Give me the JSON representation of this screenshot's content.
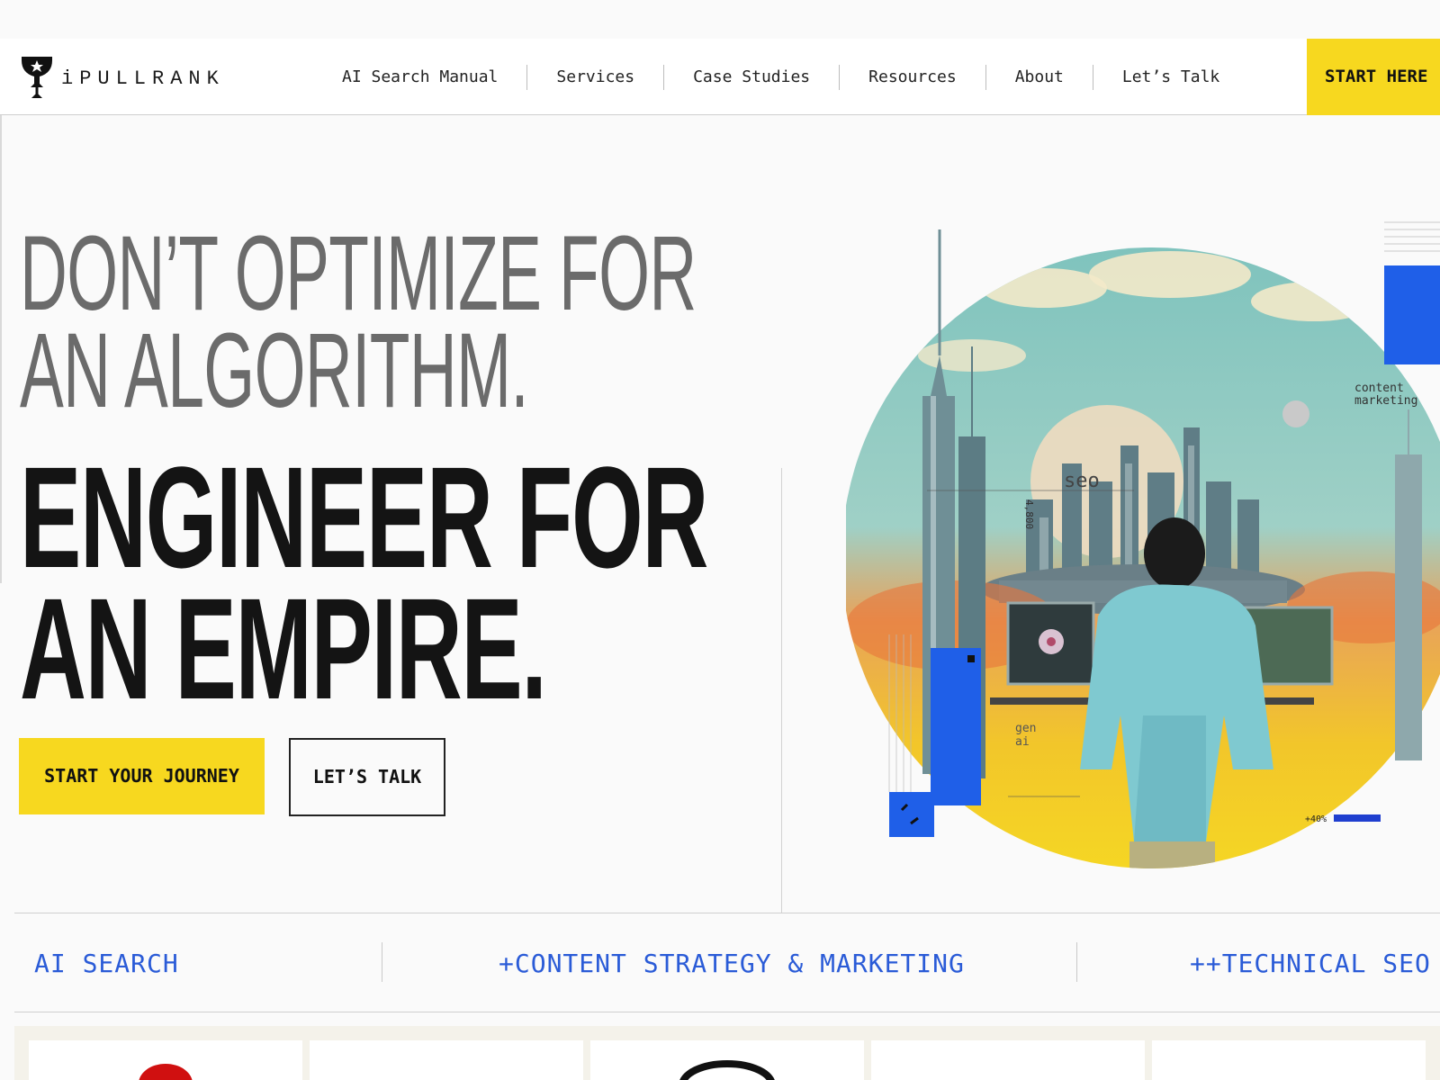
{
  "header": {
    "logo_text": "iPULLRANK",
    "nav": [
      {
        "label": "AI Search Manual"
      },
      {
        "label": "Services"
      },
      {
        "label": "Case Studies"
      },
      {
        "label": "Resources"
      },
      {
        "label": "About"
      },
      {
        "label": "Let’s Talk"
      }
    ],
    "cta_label": "START HERE"
  },
  "hero": {
    "headline_light": [
      "DON’T OPTIMIZE FOR",
      "AN ALGORITHM."
    ],
    "headline_bold": [
      "ENGINEER FOR",
      "AN EMPIRE."
    ],
    "primary_button": "START YOUR JOURNEY",
    "secondary_button": "LET’S TALK",
    "art_labels": {
      "seo": "seo",
      "content": "content",
      "marketing": "marketing",
      "gen": "gen",
      "ai": "ai",
      "number": "4,800",
      "percent": "+40%"
    }
  },
  "services": [
    {
      "label": "AI SEARCH"
    },
    {
      "label": "+CONTENT STRATEGY & MARKETING"
    },
    {
      "label": "++TECHNICAL SEO"
    }
  ],
  "colors": {
    "accent_yellow": "#f7d81f",
    "link_blue": "#2a5bd7",
    "art_blue": "#1f5fe8"
  }
}
